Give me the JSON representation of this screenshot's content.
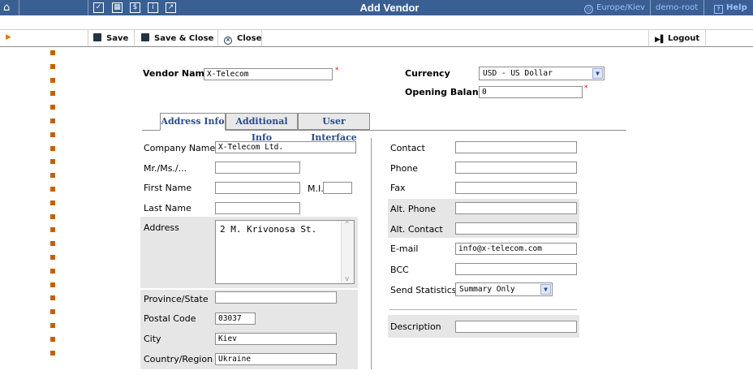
{
  "topbar": {
    "title": "Add Vendor",
    "timezone": "Europe/Kiev",
    "user": "demo-root",
    "help": "Help",
    "icons": [
      "home-icon",
      "checkbox-icon",
      "grid-icon",
      "dollar-icon",
      "info-icon",
      "chart-icon"
    ]
  },
  "toolbar": {
    "save": "Save",
    "save_close": "Save & Close",
    "close": "Close",
    "logout": "Logout"
  },
  "form": {
    "vendor_name_label": "Vendor Name",
    "vendor_name_value": "X-Telecom",
    "currency_label": "Currency",
    "currency_value": "USD - US Dollar",
    "opening_balance_label": "Opening Balance",
    "opening_balance_value": "0",
    "required_mark": "*"
  },
  "tabs": [
    {
      "label": "Address Info"
    },
    {
      "label": "Additional Info"
    },
    {
      "label": "User Interface"
    }
  ],
  "address": {
    "company_name_label": "Company Name",
    "company_name_value": "X-Telecom Ltd.",
    "salutation_label": "Mr./Ms./...",
    "salutation_value": "",
    "first_name_label": "First Name",
    "first_name_value": "",
    "mi_label": "M.I.",
    "mi_value": "",
    "last_name_label": "Last Name",
    "last_name_value": "",
    "address_label": "Address",
    "address_value": "2 M. Krivonosa St.",
    "province_label": "Province/State",
    "province_value": "",
    "postal_label": "Postal Code",
    "postal_value": "03037",
    "city_label": "City",
    "city_value": "Kiev",
    "country_label": "Country/Region",
    "country_value": "Ukraine"
  },
  "contact": {
    "contact_label": "Contact",
    "contact_value": "",
    "phone_label": "Phone",
    "phone_value": "",
    "fax_label": "Fax",
    "fax_value": "",
    "alt_phone_label": "Alt. Phone",
    "alt_phone_value": "",
    "alt_contact_label": "Alt. Contact",
    "alt_contact_value": "",
    "email_label": "E-mail",
    "email_value": "info@x-telecom.com",
    "bcc_label": "BCC",
    "bcc_value": "",
    "send_stats_label": "Send Statistics",
    "send_stats_value": "Summary Only",
    "description_label": "Description",
    "description_value": ""
  }
}
